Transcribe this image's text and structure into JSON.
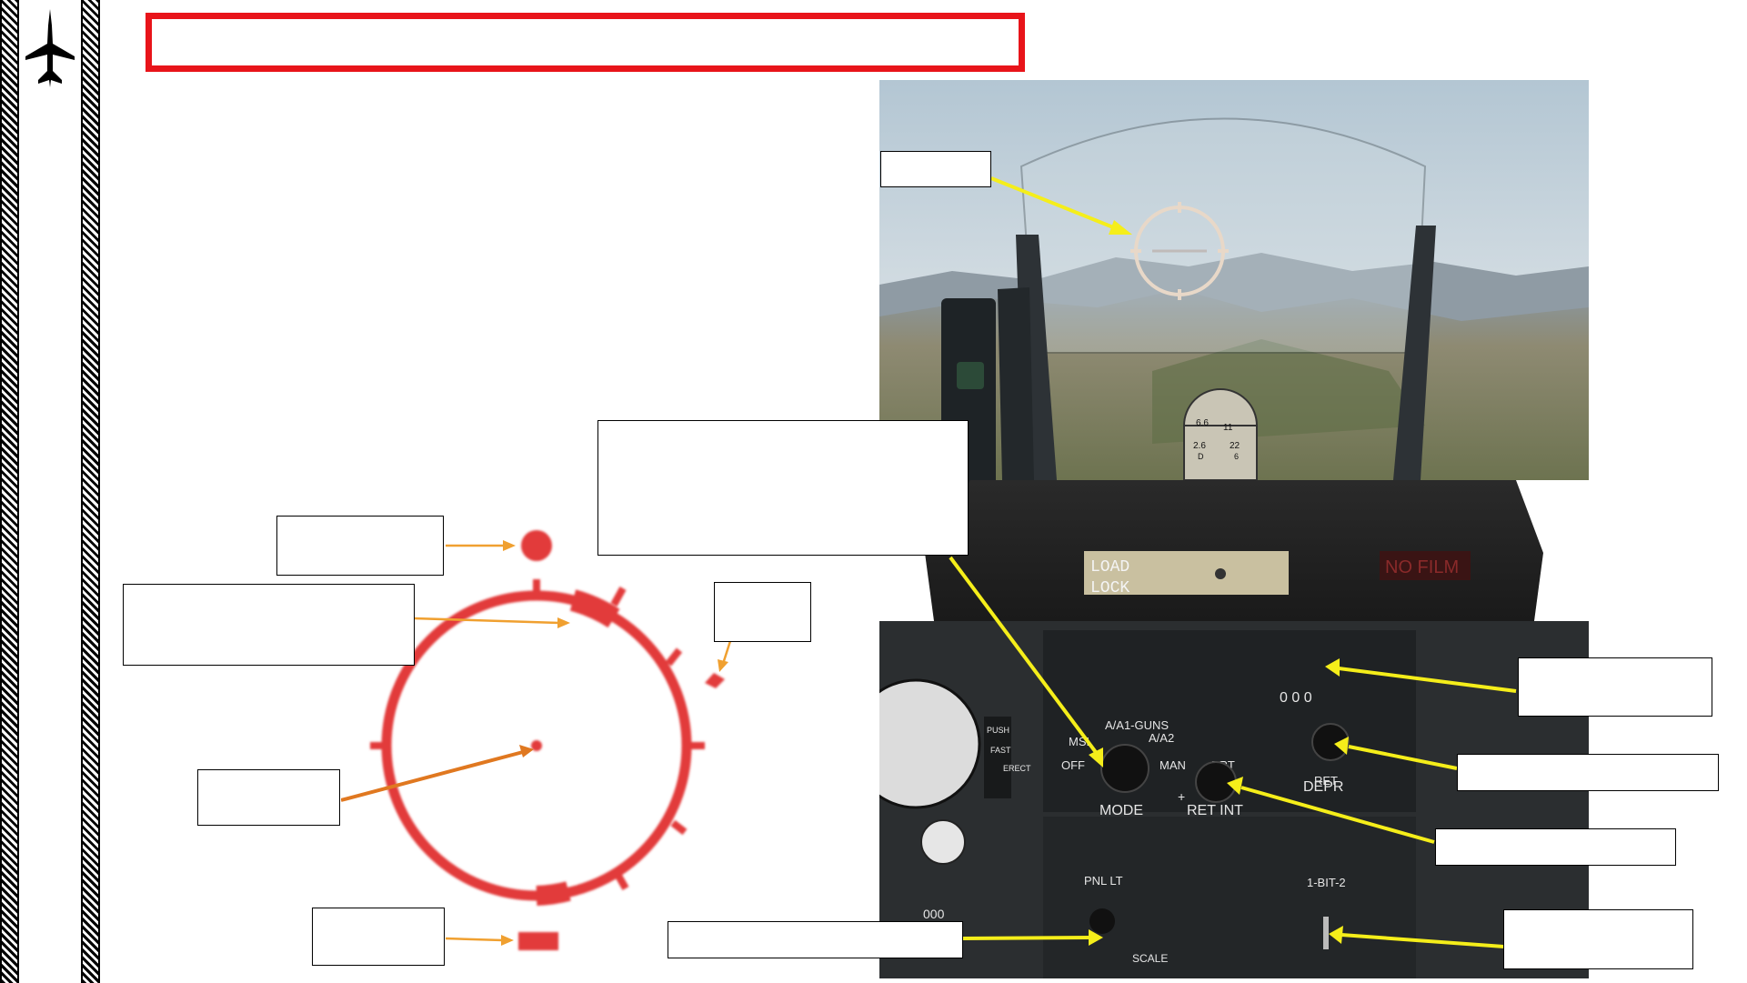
{
  "sidebar": {
    "logo_icon": "jet-silhouette-icon"
  },
  "sight_diagram": {
    "reticle_color": "#e23a3a",
    "arrow_color": "#f0a030",
    "center_arrow_color": "#e07820"
  },
  "cockpit": {
    "annotation_arrow_color": "#f5ee1a",
    "glareshield_placard": {
      "line1": "LOAD",
      "line2": "LOCK"
    },
    "no_film_text": "NO FILM",
    "gyro_dial": {
      "t1": "6.6",
      "t2": "11",
      "t3": "2.6",
      "t4": "22",
      "t5": "D",
      "t6": "6"
    },
    "mode_knob": {
      "label": "MODE",
      "off": "OFF",
      "msl": "MSL",
      "guns": "A/A1-GUNS",
      "a2": "A/A2",
      "man": "MAN"
    },
    "ret_int_knob": {
      "label": "RET INT",
      "brt": "BRT",
      "plus": "+"
    },
    "depr_knob": {
      "label": "DEPR",
      "ret": "RET"
    },
    "depr_counter": "0 0 0",
    "pnl_lt": "PNL LT",
    "bit_switch": "1-BIT-2",
    "scale": "SCALE",
    "erect_button": {
      "push": "PUSH",
      "fast": "FAST",
      "erect": "ERECT"
    },
    "side_counter": "000"
  },
  "colors": {
    "title_border": "#e8141a",
    "reticle": "#e23a3a",
    "yellow_arrow": "#f5ee1a"
  }
}
